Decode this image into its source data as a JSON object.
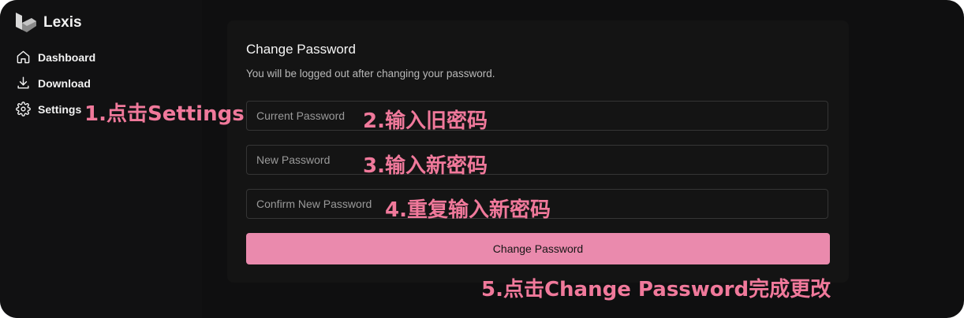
{
  "app": {
    "name": "Lexis"
  },
  "sidebar": {
    "items": [
      {
        "label": "Dashboard",
        "icon": "home-icon"
      },
      {
        "label": "Download",
        "icon": "download-icon"
      },
      {
        "label": "Settings",
        "icon": "gear-icon"
      }
    ]
  },
  "card": {
    "title": "Change Password",
    "subtitle": "You will be logged out after changing your password.",
    "fields": {
      "current_placeholder": "Current Password",
      "new_placeholder": "New Password",
      "confirm_placeholder": "Confirm New Password"
    },
    "submit_label": "Change Password"
  },
  "annotations": {
    "step1": "1.点击Settings",
    "step2": "2.输入旧密码",
    "step3": "3.输入新密码",
    "step4": "4.重复输入新密码",
    "step5": "5.点击Change Password完成更改"
  },
  "colors": {
    "accent": "#ea8aad",
    "annotation": "#f0799b",
    "background": "#0f0f10",
    "card": "#141414"
  }
}
